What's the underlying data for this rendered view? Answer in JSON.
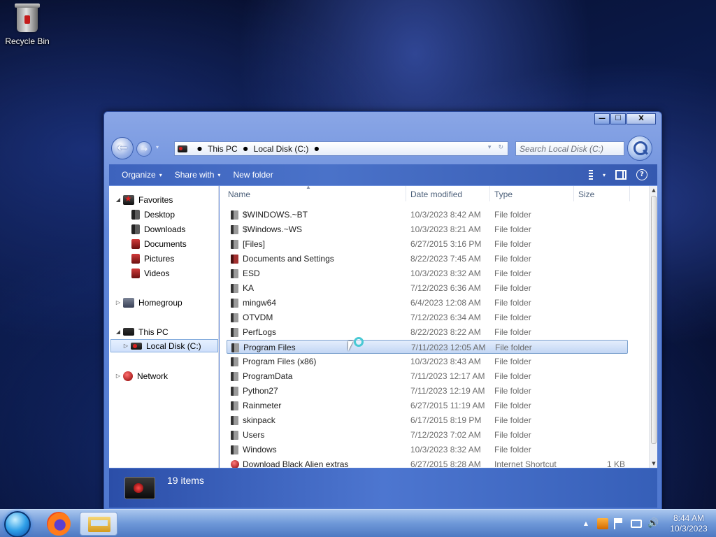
{
  "desktop": {
    "icons": [
      {
        "label": "Recycle Bin",
        "icon": "recycle-bin-icon"
      }
    ]
  },
  "window": {
    "controls": {
      "minimize": "—",
      "maximize": "☐",
      "close": "X"
    },
    "nav": {
      "back": "←",
      "forward": "→",
      "recent": "▾"
    },
    "address": {
      "crumbs": [
        "This PC",
        "Local Disk (C:)"
      ],
      "separator": "●",
      "dropdown": "▾",
      "refresh": "↻"
    },
    "search": {
      "placeholder": "Search Local Disk (C:)"
    },
    "toolbar": {
      "organize": "Organize",
      "share_with": "Share with",
      "new_folder": "New folder",
      "caret": "▾",
      "help": "?"
    },
    "nav_pane": {
      "favorites": "Favorites",
      "desktop": "Desktop",
      "downloads": "Downloads",
      "documents": "Documents",
      "pictures": "Pictures",
      "videos": "Videos",
      "homegroup": "Homegroup",
      "this_pc": "This PC",
      "local_disk": "Local Disk (C:)",
      "network": "Network",
      "expanded": "◢",
      "collapsed": "▷"
    },
    "columns": {
      "name": "Name",
      "date_modified": "Date modified",
      "type": "Type",
      "size": "Size",
      "sort_indicator": "▲"
    },
    "files": [
      {
        "name": "$WINDOWS.~BT",
        "date": "10/3/2023 8:42 AM",
        "type": "File folder",
        "size": ""
      },
      {
        "name": "$Windows.~WS",
        "date": "10/3/2023 8:21 AM",
        "type": "File folder",
        "size": ""
      },
      {
        "name": "[Files]",
        "date": "6/27/2015 3:16 PM",
        "type": "File folder",
        "size": ""
      },
      {
        "name": "Documents and Settings",
        "date": "8/22/2023 7:45 AM",
        "type": "File folder",
        "size": ""
      },
      {
        "name": "ESD",
        "date": "10/3/2023 8:32 AM",
        "type": "File folder",
        "size": ""
      },
      {
        "name": "KA",
        "date": "7/12/2023 6:36 AM",
        "type": "File folder",
        "size": ""
      },
      {
        "name": "mingw64",
        "date": "6/4/2023 12:08 AM",
        "type": "File folder",
        "size": ""
      },
      {
        "name": "OTVDM",
        "date": "7/12/2023 6:34 AM",
        "type": "File folder",
        "size": ""
      },
      {
        "name": "PerfLogs",
        "date": "8/22/2023 8:22 AM",
        "type": "File folder",
        "size": ""
      },
      {
        "name": "Program Files",
        "date": "7/11/2023 12:05 AM",
        "type": "File folder",
        "size": ""
      },
      {
        "name": "Program Files (x86)",
        "date": "10/3/2023 8:43 AM",
        "type": "File folder",
        "size": ""
      },
      {
        "name": "ProgramData",
        "date": "7/11/2023 12:17 AM",
        "type": "File folder",
        "size": ""
      },
      {
        "name": "Python27",
        "date": "7/11/2023 12:19 AM",
        "type": "File folder",
        "size": ""
      },
      {
        "name": "Rainmeter",
        "date": "6/27/2015 11:19 AM",
        "type": "File folder",
        "size": ""
      },
      {
        "name": "skinpack",
        "date": "6/17/2015 8:19 PM",
        "type": "File folder",
        "size": ""
      },
      {
        "name": "Users",
        "date": "7/12/2023 7:02 AM",
        "type": "File folder",
        "size": ""
      },
      {
        "name": "Windows",
        "date": "10/3/2023 8:32 AM",
        "type": "File folder",
        "size": ""
      },
      {
        "name": "Download Black Alien extras",
        "date": "6/27/2015 8:28 AM",
        "type": "Internet Shortcut",
        "size": "1 KB"
      }
    ],
    "selected_file": "Program Files",
    "scrollbar": {
      "up": "▲",
      "down": "▼"
    },
    "details": {
      "item_count": "19 items"
    }
  },
  "taskbar": {
    "pinned": [
      {
        "name": "firefox-icon"
      },
      {
        "name": "file-explorer-icon"
      }
    ],
    "tray": {
      "show_hidden": "▲",
      "volume": "🔊"
    },
    "clock": {
      "time": "8:44 AM",
      "date": "10/3/2023"
    }
  }
}
